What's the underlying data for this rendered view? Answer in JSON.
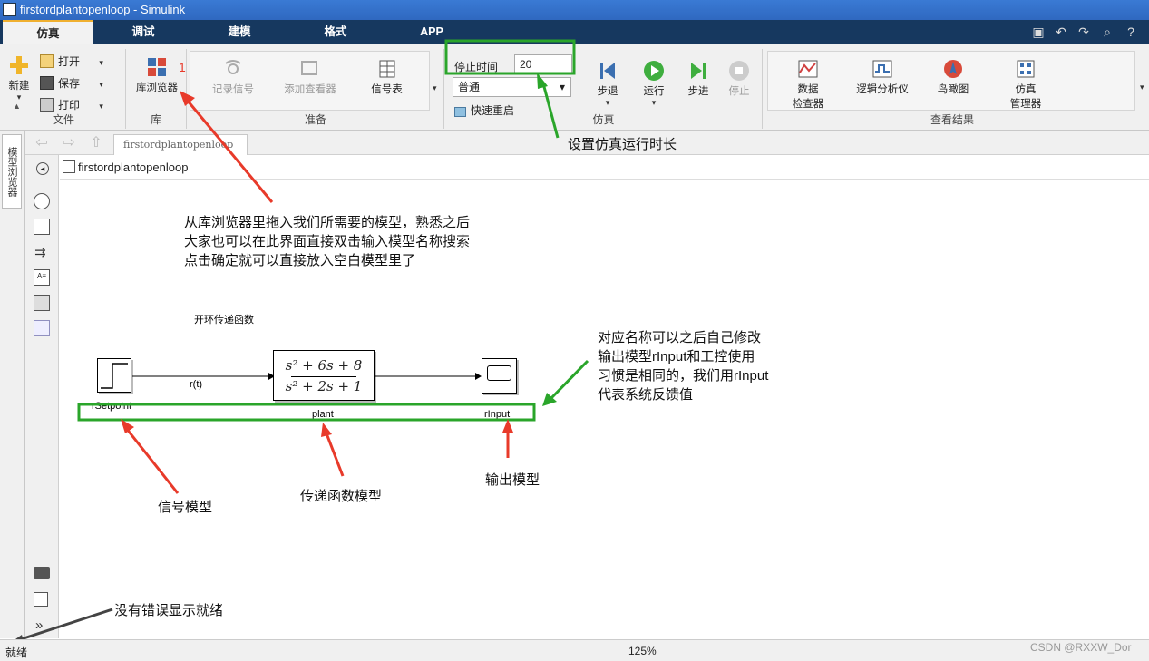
{
  "window": {
    "title": "firstordplantopenloop - Simulink"
  },
  "tabs": [
    {
      "label": "仿真"
    },
    {
      "label": "调试"
    },
    {
      "label": "建模"
    },
    {
      "label": "格式"
    },
    {
      "label": "APP"
    }
  ],
  "ribbon": {
    "file": {
      "new": "新建",
      "open": "打开",
      "save": "保存",
      "print": "打印",
      "group": "文件"
    },
    "library": {
      "browser": "库浏览器",
      "group": "库",
      "marker": "1"
    },
    "prepare": {
      "log": "记录信号",
      "viewer": "添加查看器",
      "signal_table": "信号表",
      "group": "准备"
    },
    "simulate": {
      "stop_time_label": "停止时间",
      "stop_time": "20",
      "mode": "普通",
      "fast_restart": "快速重启",
      "step_back": "步退",
      "run": "运行",
      "step_forward": "步进",
      "stop": "停止",
      "group": "仿真"
    },
    "results": {
      "data_inspector_1": "数据",
      "data_inspector_2": "检查器",
      "logic_analyzer": "逻辑分析仪",
      "birdseye": "鸟瞰图",
      "sim_manager_1": "仿真",
      "sim_manager_2": "管理器",
      "group": "查看结果"
    }
  },
  "sidebar": {
    "model_browser": "模型浏览器"
  },
  "nav": {
    "tab": "firstordplantopenloop"
  },
  "address": {
    "model": "firstordplantopenloop"
  },
  "diagram": {
    "annotation": "开环传递函数",
    "signal_label": "r(t)",
    "setpoint_label": "rSetpoint",
    "plant_label": "plant",
    "scope_label": "rInput",
    "tf_num": "s² + 6s + 8",
    "tf_den": "s² + 2s + 1"
  },
  "notes": {
    "library": [
      "从库浏览器里拖入我们所需要的模型，熟悉之后",
      "大家也可以在此界面直接双击输入模型名称搜索",
      "点击确定就可以直接放入空白模型里了"
    ],
    "stoptime": "设置仿真运行时长",
    "rename": [
      "对应名称可以之后自己修改",
      "输出模型rInput和工控使用",
      "习惯是相同的，我们用rInput",
      "代表系统反馈值"
    ],
    "signal_model": "信号模型",
    "tf_model": "传递函数模型",
    "output_model": "输出模型",
    "ready_note": "没有错误显示就绪"
  },
  "status": {
    "ready": "就绪",
    "zoom": "125%",
    "watermark": "CSDN @RXXW_Dor"
  },
  "colors": {
    "annotation_red": "#e83a2a",
    "annotation_green": "#2aa52a",
    "tabbar": "#16385f"
  }
}
